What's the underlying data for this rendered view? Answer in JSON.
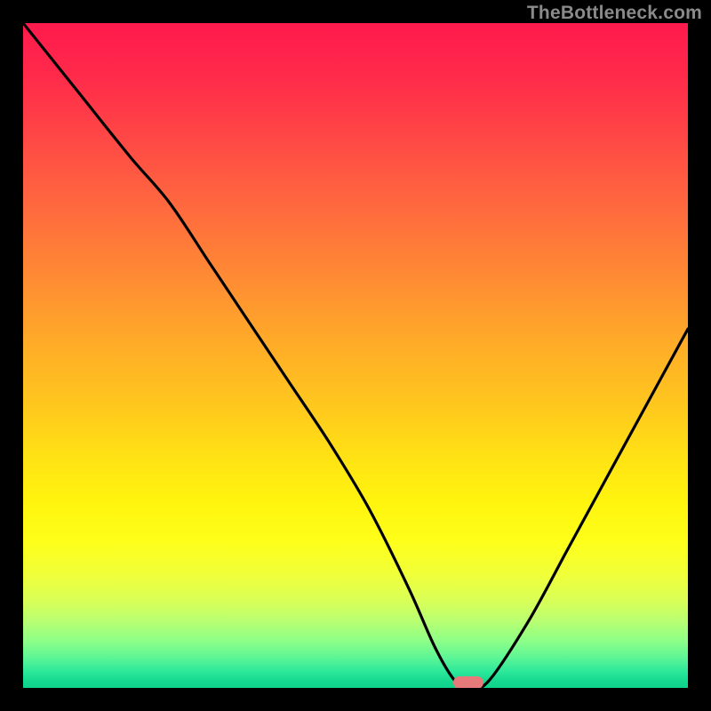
{
  "watermark": "TheBottleneck.com",
  "marker": {
    "x_pct": 67,
    "y_pct": 100
  },
  "chart_data": {
    "type": "line",
    "title": "",
    "xlabel": "",
    "ylabel": "",
    "xlim": [
      0,
      100
    ],
    "ylim": [
      0,
      100
    ],
    "series": [
      {
        "name": "bottleneck-curve",
        "x": [
          0,
          8,
          16,
          22,
          28,
          34,
          40,
          46,
          52,
          58,
          62,
          65,
          67,
          70,
          76,
          82,
          88,
          94,
          100
        ],
        "y": [
          100,
          90,
          80,
          73,
          64,
          55,
          46,
          37,
          27,
          15,
          6,
          1,
          0,
          1,
          10,
          21,
          32,
          43,
          54
        ]
      }
    ],
    "annotations": [
      {
        "type": "marker",
        "x": 67,
        "y": 0,
        "shape": "capsule",
        "color": "#e67a7a"
      }
    ],
    "background_gradient": {
      "direction": "vertical",
      "stops": [
        {
          "pos": 0,
          "color": "#ff1a4d"
        },
        {
          "pos": 50,
          "color": "#ffb020"
        },
        {
          "pos": 78,
          "color": "#feff1a"
        },
        {
          "pos": 100,
          "color": "#0fd38a"
        }
      ]
    }
  }
}
